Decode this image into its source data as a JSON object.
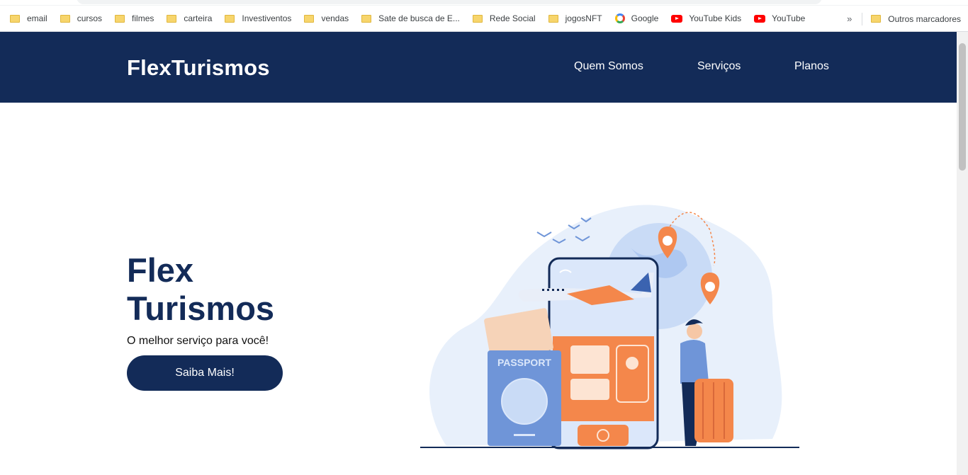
{
  "bookmarks": [
    {
      "label": "email",
      "icon": "folder-icon"
    },
    {
      "label": "cursos",
      "icon": "folder-icon"
    },
    {
      "label": "filmes",
      "icon": "folder-icon"
    },
    {
      "label": "carteira",
      "icon": "folder-icon"
    },
    {
      "label": "Investiventos",
      "icon": "folder-icon"
    },
    {
      "label": "vendas",
      "icon": "folder-icon"
    },
    {
      "label": "Sate de busca de E...",
      "icon": "folder-icon"
    },
    {
      "label": "Rede Social",
      "icon": "folder-icon"
    },
    {
      "label": "jogosNFT",
      "icon": "folder-icon"
    },
    {
      "label": "Google",
      "icon": "google-icon"
    },
    {
      "label": "YouTube Kids",
      "icon": "youtube-icon"
    },
    {
      "label": "YouTube",
      "icon": "youtube-icon"
    }
  ],
  "bookmarks_overflow": "»",
  "other_bookmarks": "Outros marcadores",
  "header": {
    "logo": "FlexTurismos",
    "nav": [
      "Quem Somos",
      "Serviços",
      "Planos"
    ]
  },
  "hero": {
    "title_line1": "Flex",
    "title_line2": "Turismos",
    "subtitle": "O melhor serviço para você!",
    "cta": "Saiba Mais!",
    "illustration_passport_text": "PASSPORT"
  },
  "colors": {
    "brand_navy": "#132b58",
    "accent_orange": "#f4874b",
    "light_blue": "#e8f0fb"
  }
}
